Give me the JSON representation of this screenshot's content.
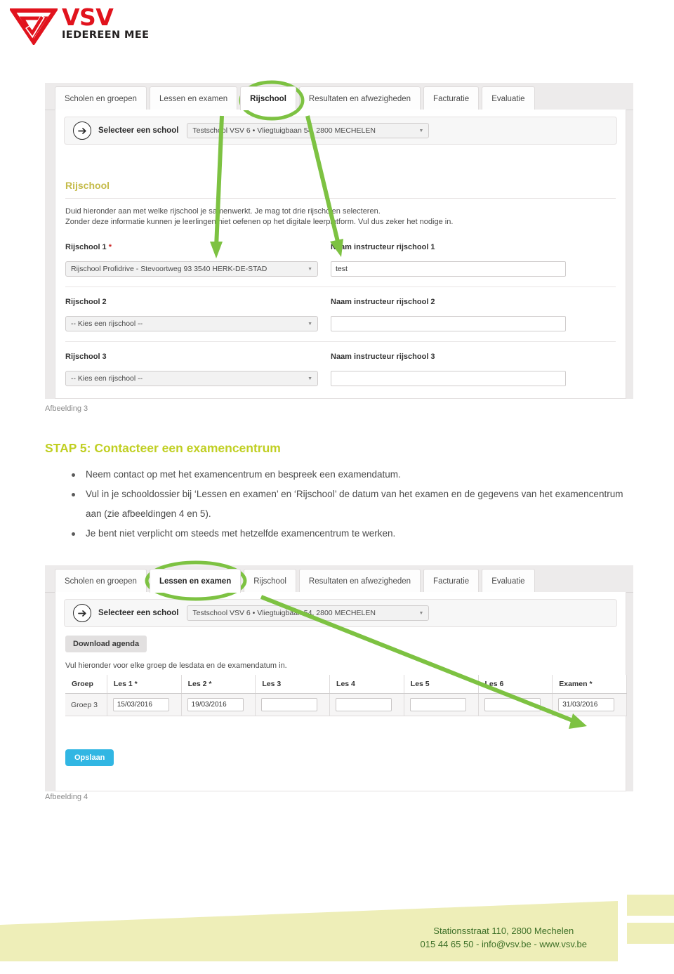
{
  "logo": {
    "brand": "VSV",
    "tagline": "IEDEREEN MEE",
    "mark_color": "#e1131d"
  },
  "figure3": {
    "caption": "Afbeelding 3",
    "tabs": [
      {
        "label": "Scholen en groepen",
        "active": false
      },
      {
        "label": "Lessen en examen",
        "active": false
      },
      {
        "label": "Rijschool",
        "active": true
      },
      {
        "label": "Resultaten en afwezigheden",
        "active": false
      },
      {
        "label": "Facturatie",
        "active": false
      },
      {
        "label": "Evaluatie",
        "active": false
      }
    ],
    "school_selector": {
      "label": "Selecteer een school",
      "value": "Testschool VSV 6 • Vliegtuigbaan 54, 2800 MECHELEN",
      "icon": "arrow-right-icon"
    },
    "section_title": "Rijschool",
    "paragraph_line1": "Duid hieronder aan met welke rijschool je samenwerkt. Je mag tot drie rijscholen selecteren.",
    "paragraph_line2": "Zonder deze informatie kunnen je leerlingen niet oefenen op het digitale leerplatform. Vul dus zeker het nodige in.",
    "rows": [
      {
        "school_label": "Rijschool 1",
        "required": true,
        "school_value": "Rijschool Profidrive - Stevoortweg 93 3540 HERK-DE-STAD",
        "instructor_label": "Naam instructeur rijschool 1",
        "instructor_value": "test"
      },
      {
        "school_label": "Rijschool 2",
        "required": false,
        "school_value": "-- Kies een rijschool --",
        "instructor_label": "Naam instructeur rijschool 2",
        "instructor_value": ""
      },
      {
        "school_label": "Rijschool 3",
        "required": false,
        "school_value": "-- Kies een rijschool --",
        "instructor_label": "Naam instructeur rijschool 3",
        "instructor_value": ""
      }
    ],
    "annotation": {
      "highlight_tab": "Rijschool",
      "color": "#7dc242"
    }
  },
  "step": {
    "heading": "STAP 5: Contacteer een examencentrum",
    "heading_color": "#c0cf22",
    "bullets": [
      "Neem contact op met het examencentrum en bespreek een examendatum.",
      "Vul in je schooldossier bij ‘Lessen en examen’ en ‘Rijschool’ de datum van het examen en de gegevens van het examencentrum aan (zie afbeeldingen 4 en 5).",
      "Je bent niet verplicht om steeds met hetzelfde examencentrum te werken."
    ]
  },
  "figure4": {
    "caption": "Afbeelding 4",
    "tabs": [
      {
        "label": "Scholen en groepen",
        "active": false
      },
      {
        "label": "Lessen en examen",
        "active": true
      },
      {
        "label": "Rijschool",
        "active": false
      },
      {
        "label": "Resultaten en afwezigheden",
        "active": false
      },
      {
        "label": "Facturatie",
        "active": false
      },
      {
        "label": "Evaluatie",
        "active": false
      }
    ],
    "school_selector": {
      "label": "Selecteer een school",
      "value": "Testschool VSV 6 • Vliegtuigbaan 54, 2800 MECHELEN",
      "icon": "arrow-right-icon"
    },
    "download_button": "Download agenda",
    "instruction": "Vul hieronder voor elke groep de lesdata en de examendatum in.",
    "table": {
      "headers": [
        "Groep",
        "Les 1 *",
        "Les 2 *",
        "Les 3",
        "Les 4",
        "Les 5",
        "Les 6",
        "Examen *"
      ],
      "rows": [
        {
          "groep": "Groep 3",
          "cells": [
            "15/03/2016",
            "19/03/2016",
            "",
            "",
            "",
            "",
            "31/03/2016"
          ]
        }
      ]
    },
    "save_button": "Opslaan",
    "save_button_color": "#31b6e3",
    "annotation": {
      "highlight_tab": "Lessen en examen",
      "color": "#7dc242"
    }
  },
  "footer": {
    "address": "Stationsstraat 110, 2800 Mechelen",
    "contact": "015 44 65 50 - info@vsv.be - www.vsv.be",
    "band_color": "#eeeeb8",
    "text_color": "#3e7028"
  }
}
